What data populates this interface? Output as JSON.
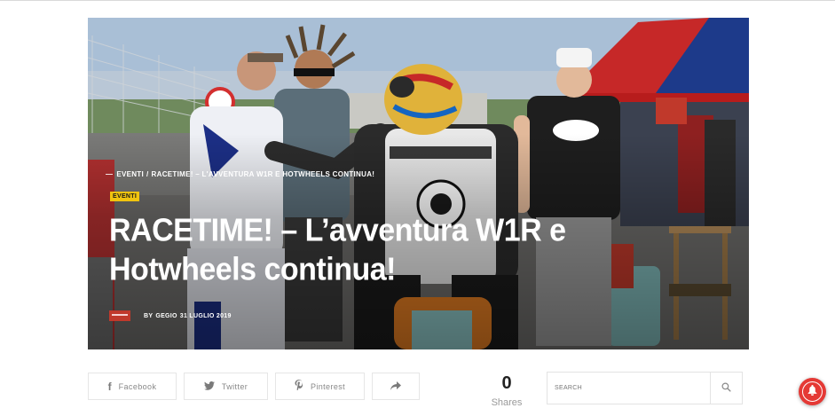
{
  "hero": {
    "image_alt": "Riders and team at the race track paddock",
    "breadcrumb": {
      "category": "EVENTI",
      "separator": "/",
      "current": "RACETIME! – L'AVVENTURA W1R E HOTWHEELS CONTINUA!"
    },
    "badge": "EVENTI",
    "title": "RACETIME! – L’avventura W1R e Hotwheels continua!",
    "byline": {
      "prefix": "BY",
      "author": "GEGIO",
      "date": "31 LUGLIO 2019"
    }
  },
  "share": {
    "buttons": [
      {
        "label": "Facebook",
        "icon": "facebook-icon"
      },
      {
        "label": "Twitter",
        "icon": "twitter-icon"
      },
      {
        "label": "Pinterest",
        "icon": "pinterest-icon"
      },
      {
        "label": "",
        "icon": "share-arrow-icon"
      }
    ],
    "count": "0",
    "count_label": "Shares"
  },
  "search": {
    "placeholder": "SEARCH",
    "icon": "search-icon"
  },
  "notification": {
    "icon": "bell-icon",
    "color": "#e53935"
  },
  "colors": {
    "badge": "#f1c40f",
    "hero_text": "#ffffff"
  }
}
